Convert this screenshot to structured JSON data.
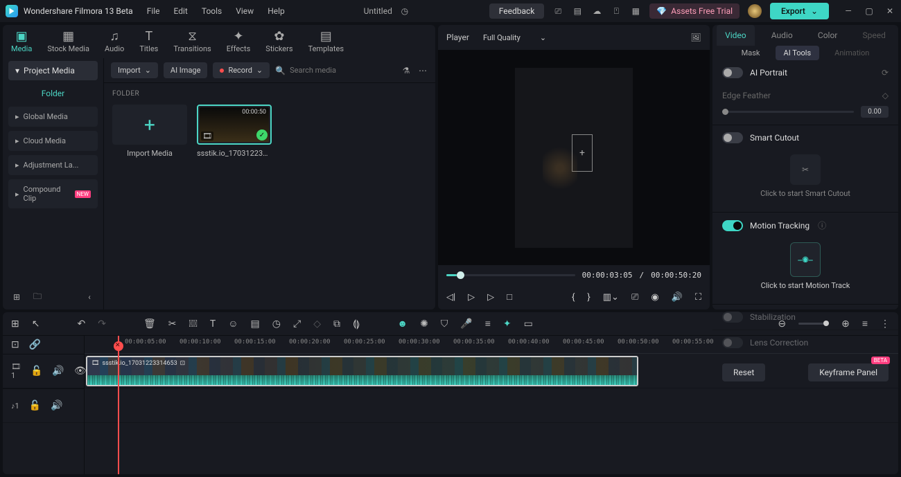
{
  "app": {
    "name": "Wondershare Filmora 13 Beta",
    "doc_title": "Untitled"
  },
  "menu": [
    "File",
    "Edit",
    "Tools",
    "View",
    "Help"
  ],
  "titlebar": {
    "feedback": "Feedback",
    "assets": "Assets Free Trial",
    "export": "Export"
  },
  "asset_tabs": [
    {
      "label": "Media",
      "active": true
    },
    {
      "label": "Stock Media"
    },
    {
      "label": "Audio"
    },
    {
      "label": "Titles"
    },
    {
      "label": "Transitions"
    },
    {
      "label": "Effects"
    },
    {
      "label": "Stickers"
    },
    {
      "label": "Templates"
    }
  ],
  "sidebar": {
    "project_media": "Project Media",
    "folder": "Folder",
    "tree": [
      {
        "label": "Global Media"
      },
      {
        "label": "Cloud Media"
      },
      {
        "label": "Adjustment La..."
      },
      {
        "label": "Compound Clip",
        "new": true
      }
    ]
  },
  "media_toolbar": {
    "import": "Import",
    "ai": "AI Image",
    "record": "Record",
    "search_ph": "Search media"
  },
  "folder_heading": "FOLDER",
  "thumbs": {
    "import": "Import Media",
    "clip": {
      "name": "ssstik.io_17031223314...",
      "dur": "00:00:50"
    }
  },
  "preview": {
    "player": "Player",
    "quality": "Full Quality",
    "time_cur": "00:00:03:05",
    "time_sep": "/",
    "time_tot": "00:00:50:20"
  },
  "right": {
    "tabs": [
      "Video",
      "Audio",
      "Color",
      "Speed"
    ],
    "active_tab": 0,
    "subtabs": [
      "Mask",
      "AI Tools",
      "Animation"
    ],
    "active_sub": 1,
    "ai_portrait": "AI Portrait",
    "edge_feather": "Edge Feather",
    "edge_val": "0.00",
    "smart_cutout": "Smart Cutout",
    "cutout_desc": "Click to start Smart Cutout",
    "motion_tracking": "Motion Tracking",
    "motion_desc": "Click to start Motion Track",
    "stabilization": "Stabilization",
    "lens": "Lens Correction",
    "reset": "Reset",
    "keyframe": "Keyframe Panel",
    "beta": "BETA"
  },
  "timeline": {
    "ruler": [
      "00:00:05:00",
      "00:00:10:00",
      "00:00:15:00",
      "00:00:20:00",
      "00:00:25:00",
      "00:00:30:00",
      "00:00:35:00",
      "00:00:40:00",
      "00:00:45:00",
      "00:00:50:00",
      "00:00:55:00"
    ],
    "clip_name": "ssstik.io_17031223314653"
  }
}
